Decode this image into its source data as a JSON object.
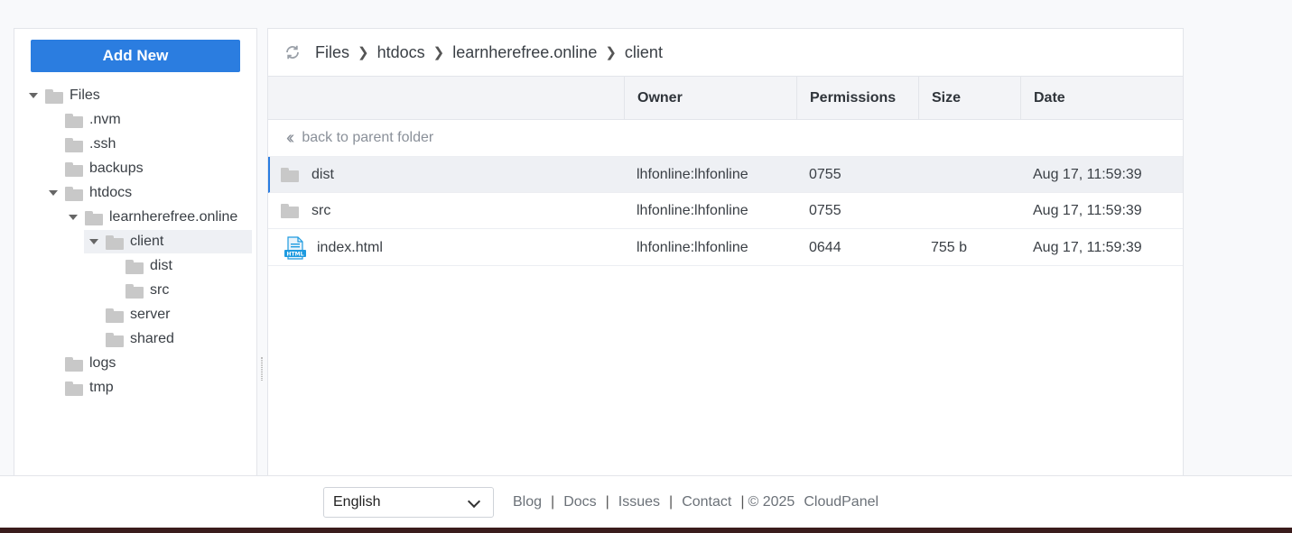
{
  "sidebar": {
    "add_new_label": "Add New",
    "tree": [
      {
        "label": "Files",
        "expanded": true
      },
      {
        "label": ".nvm"
      },
      {
        "label": ".ssh"
      },
      {
        "label": "backups"
      },
      {
        "label": "htdocs",
        "expanded": true
      },
      {
        "label": "learnherefree.online",
        "expanded": true
      },
      {
        "label": "client",
        "expanded": true,
        "selected": true
      },
      {
        "label": "dist"
      },
      {
        "label": "src"
      },
      {
        "label": "server"
      },
      {
        "label": "shared"
      },
      {
        "label": "logs"
      },
      {
        "label": "tmp"
      }
    ]
  },
  "breadcrumb": [
    "Files",
    "htdocs",
    "learnherefree.online",
    "client"
  ],
  "table": {
    "columns": [
      "",
      "Owner",
      "Permissions",
      "Size",
      "Date"
    ],
    "back_label": "back to parent folder",
    "rows": [
      {
        "name": "dist",
        "type": "folder",
        "owner": "lhfonline:lhfonline",
        "permissions": "0755",
        "size": "",
        "date": "Aug 17, 11:59:39"
      },
      {
        "name": "src",
        "type": "folder",
        "owner": "lhfonline:lhfonline",
        "permissions": "0755",
        "size": "",
        "date": "Aug 17, 11:59:39"
      },
      {
        "name": "index.html",
        "type": "html",
        "owner": "lhfonline:lhfonline",
        "permissions": "0644",
        "size": "755 b",
        "date": "Aug 17, 11:59:39"
      }
    ]
  },
  "footer": {
    "language": "English",
    "links": [
      "Blog",
      "Docs",
      "Issues",
      "Contact"
    ],
    "copyright": "© 2025",
    "brand": "CloudPanel"
  },
  "colors": {
    "accent": "#2b7de0",
    "folder": "#c8c8c8",
    "html_icon": "#1e9be0"
  },
  "icons": {
    "refresh": "refresh-icon",
    "folder": "folder-icon",
    "html_file": "html-file-icon",
    "back": "double-chevron-left-icon",
    "caret": "caret-down-icon",
    "select": "chevron-down-icon"
  }
}
